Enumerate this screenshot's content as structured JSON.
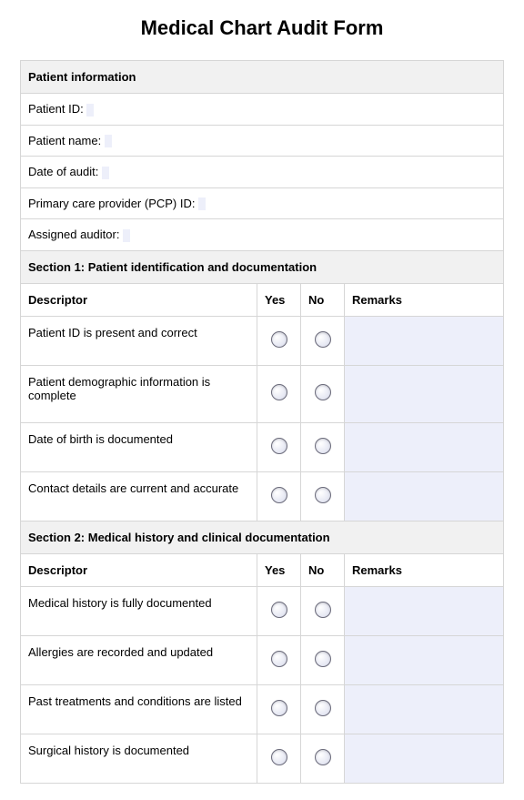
{
  "title": "Medical Chart Audit Form",
  "patient_info": {
    "header": "Patient information",
    "rows": [
      {
        "label": "Patient ID:",
        "value": ""
      },
      {
        "label": "Patient name:",
        "value": ""
      },
      {
        "label": "Date of audit:",
        "value": ""
      },
      {
        "label": "Primary care provider (PCP) ID:",
        "value": ""
      },
      {
        "label": "Assigned auditor:",
        "value": ""
      }
    ]
  },
  "columns": {
    "descriptor": "Descriptor",
    "yes": "Yes",
    "no": "No",
    "remarks": "Remarks"
  },
  "sections": [
    {
      "header": "Section 1: Patient identification and documentation",
      "rows": [
        {
          "desc": "Patient ID is present and correct",
          "remarks": ""
        },
        {
          "desc": "Patient demographic information is complete",
          "remarks": ""
        },
        {
          "desc": "Date of birth is documented",
          "remarks": ""
        },
        {
          "desc": "Contact details are current and accurate",
          "remarks": ""
        }
      ]
    },
    {
      "header": "Section 2: Medical history and clinical documentation",
      "rows": [
        {
          "desc": "Medical history is fully documented",
          "remarks": ""
        },
        {
          "desc": "Allergies are recorded and updated",
          "remarks": ""
        },
        {
          "desc": "Past treatments and conditions are listed",
          "remarks": ""
        },
        {
          "desc": "Surgical history is documented",
          "remarks": ""
        }
      ]
    }
  ]
}
